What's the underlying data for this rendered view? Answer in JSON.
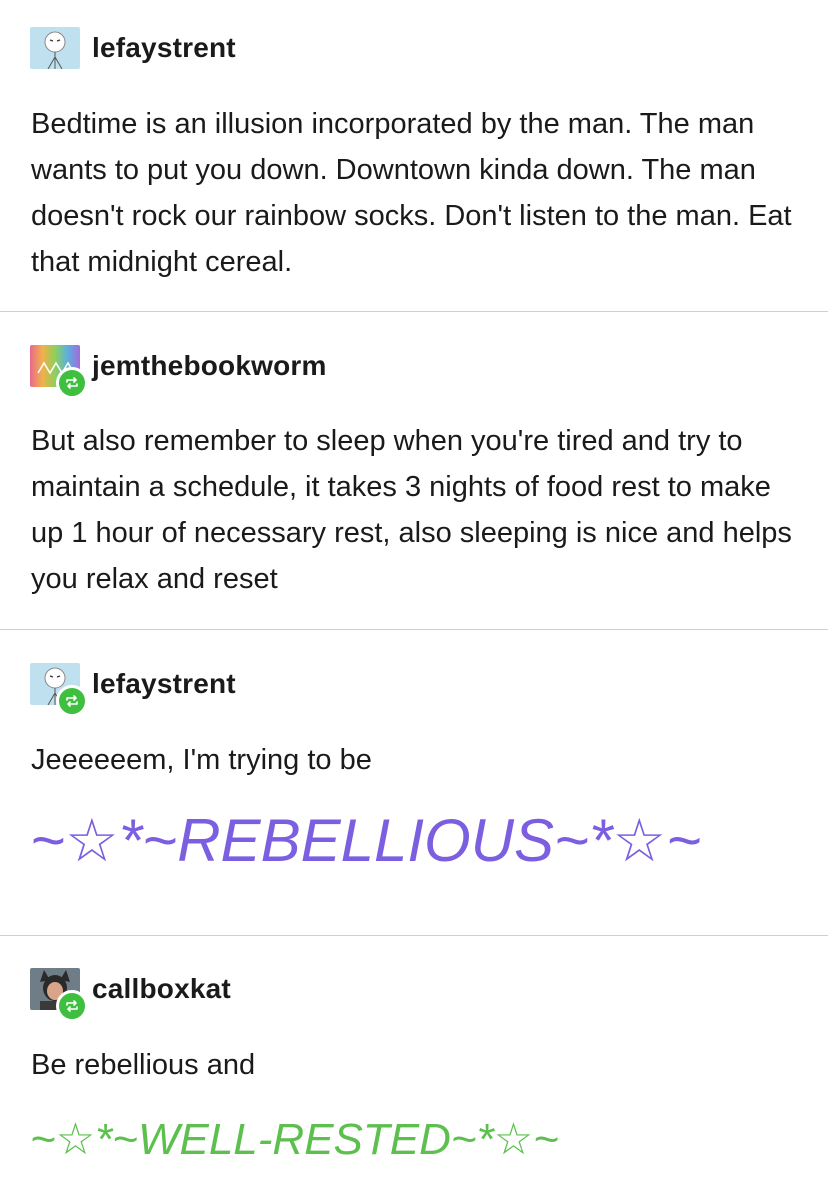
{
  "posts": [
    {
      "username": "lefaystrent",
      "avatar_icon": "stick-figure-avatar-icon",
      "reblogged": false,
      "text": "Bedtime is an illusion incorporated by the man. The man wants to put you down. Downtown kinda down. The man doesn't rock our rainbow socks. Don't listen to the man. Eat that midnight cereal."
    },
    {
      "username": "jemthebookworm",
      "avatar_icon": "rainbow-avatar-icon",
      "reblogged": true,
      "text": "But also remember to sleep when you're tired and try to maintain a schedule, it takes 3 nights of food rest to make up 1 hour of necessary rest, also sleeping is nice and helps you relax and reset"
    },
    {
      "username": "lefaystrent",
      "avatar_icon": "stick-figure-avatar-icon",
      "reblogged": true,
      "text": "Jeeeeeem, I'm trying to be",
      "fancy_text": "~☆*~REBELLIOUS~*☆~"
    },
    {
      "username": "callboxkat",
      "avatar_icon": "cat-ears-person-avatar-icon",
      "reblogged": true,
      "text": "Be rebellious and",
      "fancy_text": "~☆*~WELL-RESTED~*☆~"
    }
  ],
  "colors": {
    "reblog_badge": "#3fbf3f",
    "rebellious_text": "#7b5fe0",
    "well_rested_text": "#5dc04e",
    "divider": "#cfcfcf"
  }
}
